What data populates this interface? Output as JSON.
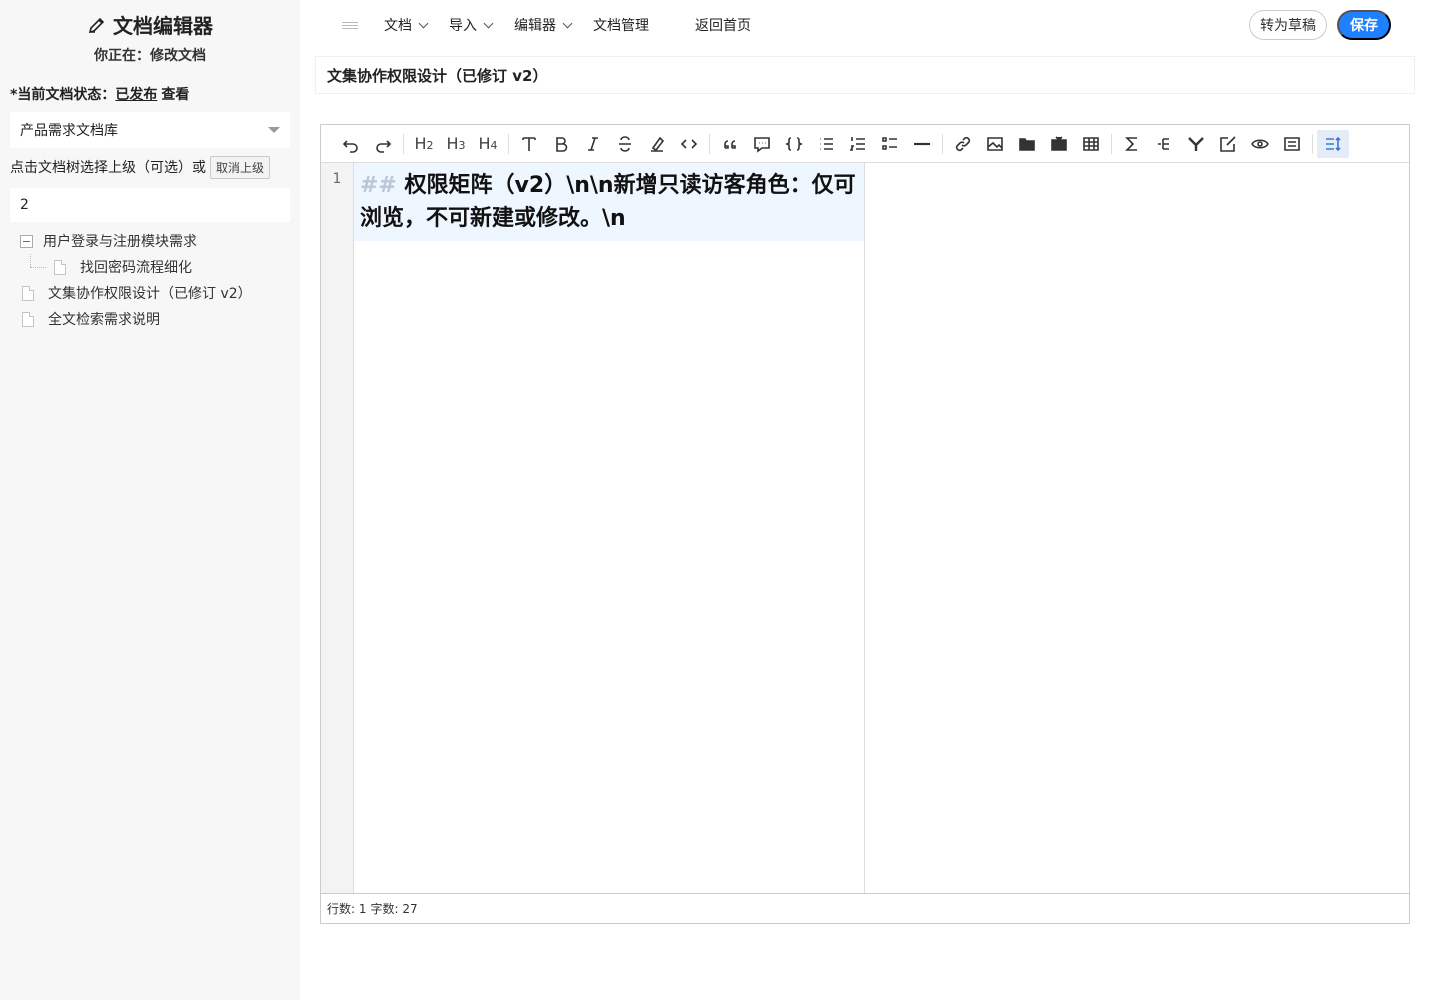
{
  "sidebar": {
    "title": "文档编辑器",
    "subtitle": "你正在：修改文档",
    "status_label": "*当前文档状态：",
    "status_value": "已发布",
    "status_view": "查看",
    "library_select": "产品需求文档库",
    "parent_hint": "点击文档树选择上级（可选）或",
    "cancel_parent": "取消上级",
    "order_value": "2",
    "tree": [
      {
        "label": "用户登录与注册模块需求",
        "children": [
          {
            "label": "找回密码流程细化"
          }
        ]
      },
      {
        "label": "文集协作权限设计（已修订 v2）"
      },
      {
        "label": "全文检索需求说明"
      }
    ]
  },
  "nav": {
    "doc": "文档",
    "import": "导入",
    "editor": "编辑器",
    "manage": "文档管理",
    "home": "返回首页",
    "draft_button": "转为草稿",
    "save_button": "保存"
  },
  "doc": {
    "title": "文集协作权限设计（已修订 v2）"
  },
  "editor": {
    "toolbar": {
      "h2": "H",
      "h3": "H",
      "h4": "H"
    },
    "line_number": "1",
    "hash": "##",
    "content": "权限矩阵（v2）\\n\\n新增只读访客角色：仅可浏览，不可新建或修改。\\n",
    "status_lines": "行数: 1",
    "status_chars": "字数: 27"
  },
  "colors": {
    "primary": "#1e80ff",
    "sidebar_bg": "#f7f7f7",
    "active_line": "#eef6ff"
  }
}
